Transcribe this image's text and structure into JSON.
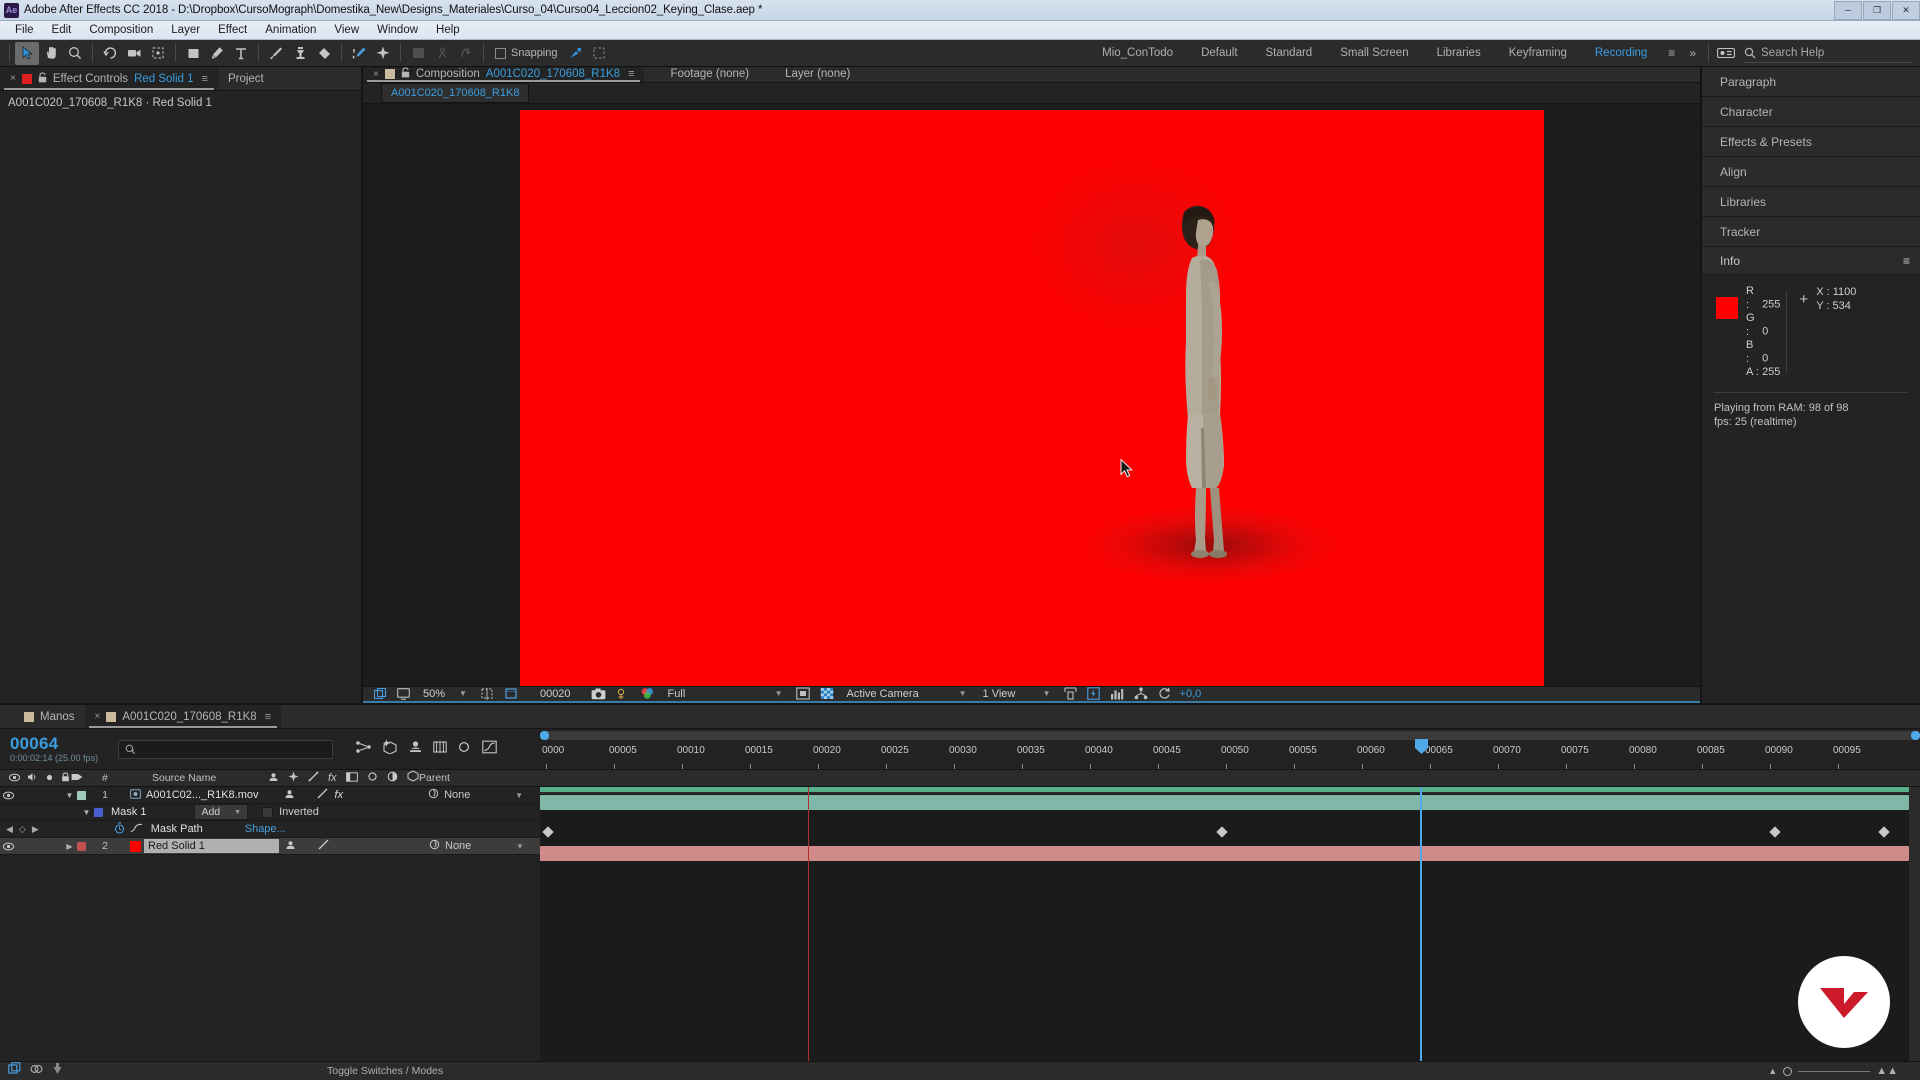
{
  "window": {
    "app_title": "Adobe After Effects CC 2018 - D:\\Dropbox\\CursoMograph\\Domestika_New\\Designs_Materiales\\Curso_04\\Curso04_Leccion02_Keying_Clase.aep *",
    "logo_text": "Ae",
    "minimize": "─",
    "maximize": "❐",
    "close": "✕"
  },
  "menubar": {
    "items": [
      "File",
      "Edit",
      "Composition",
      "Layer",
      "Effect",
      "Animation",
      "View",
      "Window",
      "Help"
    ]
  },
  "toolbar": {
    "snapping_label": "Snapping",
    "workspaces": [
      "Mio_ConTodo",
      "Default",
      "Standard",
      "Small Screen",
      "Libraries",
      "Keyframing",
      "Recording"
    ],
    "active_workspace": "Recording",
    "search_placeholder": "Search Help",
    "overflow_label": "»",
    "menu_glyph": "≡"
  },
  "left_panel": {
    "tab_effect_controls": "Effect Controls",
    "tab_effect_controls_item": "Red Solid 1",
    "tab_project": "Project",
    "subtitle": "A001C020_170608_R1K8 · Red Solid 1",
    "close_glyph": "×",
    "lock_glyph": "🔓",
    "menu_glyph": "≡"
  },
  "comp_panel": {
    "tab_composition_label": "Composition",
    "tab_composition_name": "A001C020_170608_R1K8",
    "tab_footage": "Footage (none)",
    "tab_layer": "Layer (none)",
    "subtab_name": "A001C020_170608_R1K8",
    "close_glyph": "×",
    "menu_glyph": "≡"
  },
  "viewer_bar": {
    "magnification": "50%",
    "timecode": "00020",
    "resolution": "Full",
    "camera": "Active Camera",
    "views": "1 View",
    "exposure": "+0,0"
  },
  "right_panel": {
    "panels": [
      "Paragraph",
      "Character",
      "Effects & Presets",
      "Align",
      "Libraries",
      "Tracker"
    ],
    "info_title": "Info",
    "info_menu_glyph": "≡",
    "color": {
      "r_label": "R :",
      "r_value": "255",
      "g_label": "G :",
      "g_value": "0",
      "b_label": "B :",
      "b_value": "0",
      "a_label": "A :",
      "a_value": "255",
      "swatch_hex": "#ff0000"
    },
    "position": {
      "x_label": "X :",
      "x_value": "1100",
      "y_label": "Y :",
      "y_value": "534"
    },
    "ram_line1": "Playing from RAM: 98 of 98",
    "ram_line2": "fps: 25 (realtime)"
  },
  "timeline": {
    "tab_manos": "Manos",
    "tab_active": "A001C020_170608_R1K8",
    "close_glyph": "×",
    "menu_glyph": "≡",
    "current_time": "00064",
    "time_sub": "0:00:02:14 (25.00 fps)",
    "search_placeholder": "",
    "columns": {
      "source_name": "Source Name",
      "parent": "Parent",
      "hash": "#"
    },
    "layers": [
      {
        "index": "1",
        "name": "A001C02..._R1K8.mov",
        "color": "#9fc9bb",
        "parent": "None",
        "selected": false,
        "bar_color": "#7fb8a8"
      },
      {
        "index": "2",
        "name": "Red Solid 1",
        "color": "#c05050",
        "parent": "None",
        "selected": true,
        "bar_color": "#d08a8a"
      }
    ],
    "mask": {
      "name": "Mask 1",
      "mode": "Add",
      "inverted": "Inverted",
      "swatch": "#4a5fd0",
      "path_label": "Mask Path",
      "path_value": "Shape..."
    },
    "ruler_ticks": [
      "0000",
      "00005",
      "00010",
      "00015",
      "00020",
      "00025",
      "00030",
      "00035",
      "00040",
      "00045",
      "00050",
      "00055",
      "00060",
      "00065",
      "00070",
      "00075",
      "00080",
      "00085",
      "00090",
      "00095"
    ],
    "toggle_switches": "Toggle Switches / Modes"
  }
}
